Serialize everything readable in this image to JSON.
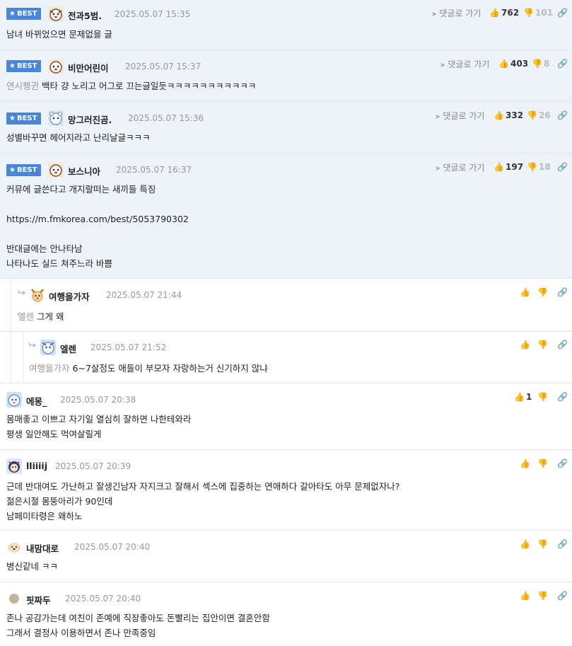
{
  "labels": {
    "best": "BEST",
    "go_reply": "댓글로 가기"
  },
  "comments": [
    {
      "nick": "전과5범.",
      "date": "2025.05.07 15:35",
      "up": "762",
      "down": "101",
      "lines": [
        "남녀 바뀌었으면 문제없을 글"
      ]
    },
    {
      "nick": "비만어린이",
      "date": "2025.05.07 15:37",
      "up": "403",
      "down": "8",
      "mention": "연시펭귄",
      "lines": [
        "백타 걍 노리고 어그로 끄는글일듯ㅋㅋㅋㅋㅋㅋㅋㅋㅋㅋㅋ"
      ]
    },
    {
      "nick": "망그러진곰.",
      "date": "2025.05.07 15:36",
      "up": "332",
      "down": "26",
      "lines": [
        "성별바꾸면 헤어지라고 난리날글ㅋㅋㅋ"
      ]
    },
    {
      "nick": "보스니아",
      "date": "2025.05.07 16:37",
      "up": "197",
      "down": "18",
      "lines": [
        "커뮤에 글쓴다고 개지랄떠는 새끼들 특징",
        "",
        "https://m.fmkorea.com/best/5053790302",
        "",
        "반대글에는 안나타남",
        "나타나도 실드 쳐주느라 바쁨"
      ]
    },
    {
      "nick": "여행을가자",
      "date": "2025.05.07 21:44",
      "mention": "엘렌",
      "lines": [
        "그게 왜"
      ]
    },
    {
      "nick": "엘렌",
      "date": "2025.05.07 21:52",
      "mention": "여행을가자",
      "lines": [
        "6~7살정도 애들이 부모자 자랑하는거 신기하지 않냐"
      ]
    },
    {
      "nick": "에몽_",
      "date": "2025.05.07 20:38",
      "up": "1",
      "lines": [
        "몸매좋고 이쁘고 자기일 열심히 잘하면 나한테와라",
        "평생 일안해도 먹여살릴게"
      ]
    },
    {
      "nick": "lliiiij",
      "date": "2025.05.07 20:39",
      "lines": [
        "근데 반대여도 가난하고 잘생긴남자 자지크고 잘해서 섹스에 집중하는 연애하다 갈아타도 아무 문제없자나?",
        "젊은시절 몸뚱아리가 90인데",
        "남페미타령은 왜하노"
      ]
    },
    {
      "nick": "내맘대로",
      "date": "2025.05.07 20:40",
      "lines": [
        "병신같네 ㅋㅋ"
      ]
    },
    {
      "nick": "핏짜두",
      "date": "2025.05.07 20:40",
      "lines": [
        "존나 공감가는데 여친이 존예에 직장좋아도 돈빨리는 집안이면 결혼안함",
        "그래서 결정사 이용하면서 존나 만족중임"
      ]
    }
  ]
}
